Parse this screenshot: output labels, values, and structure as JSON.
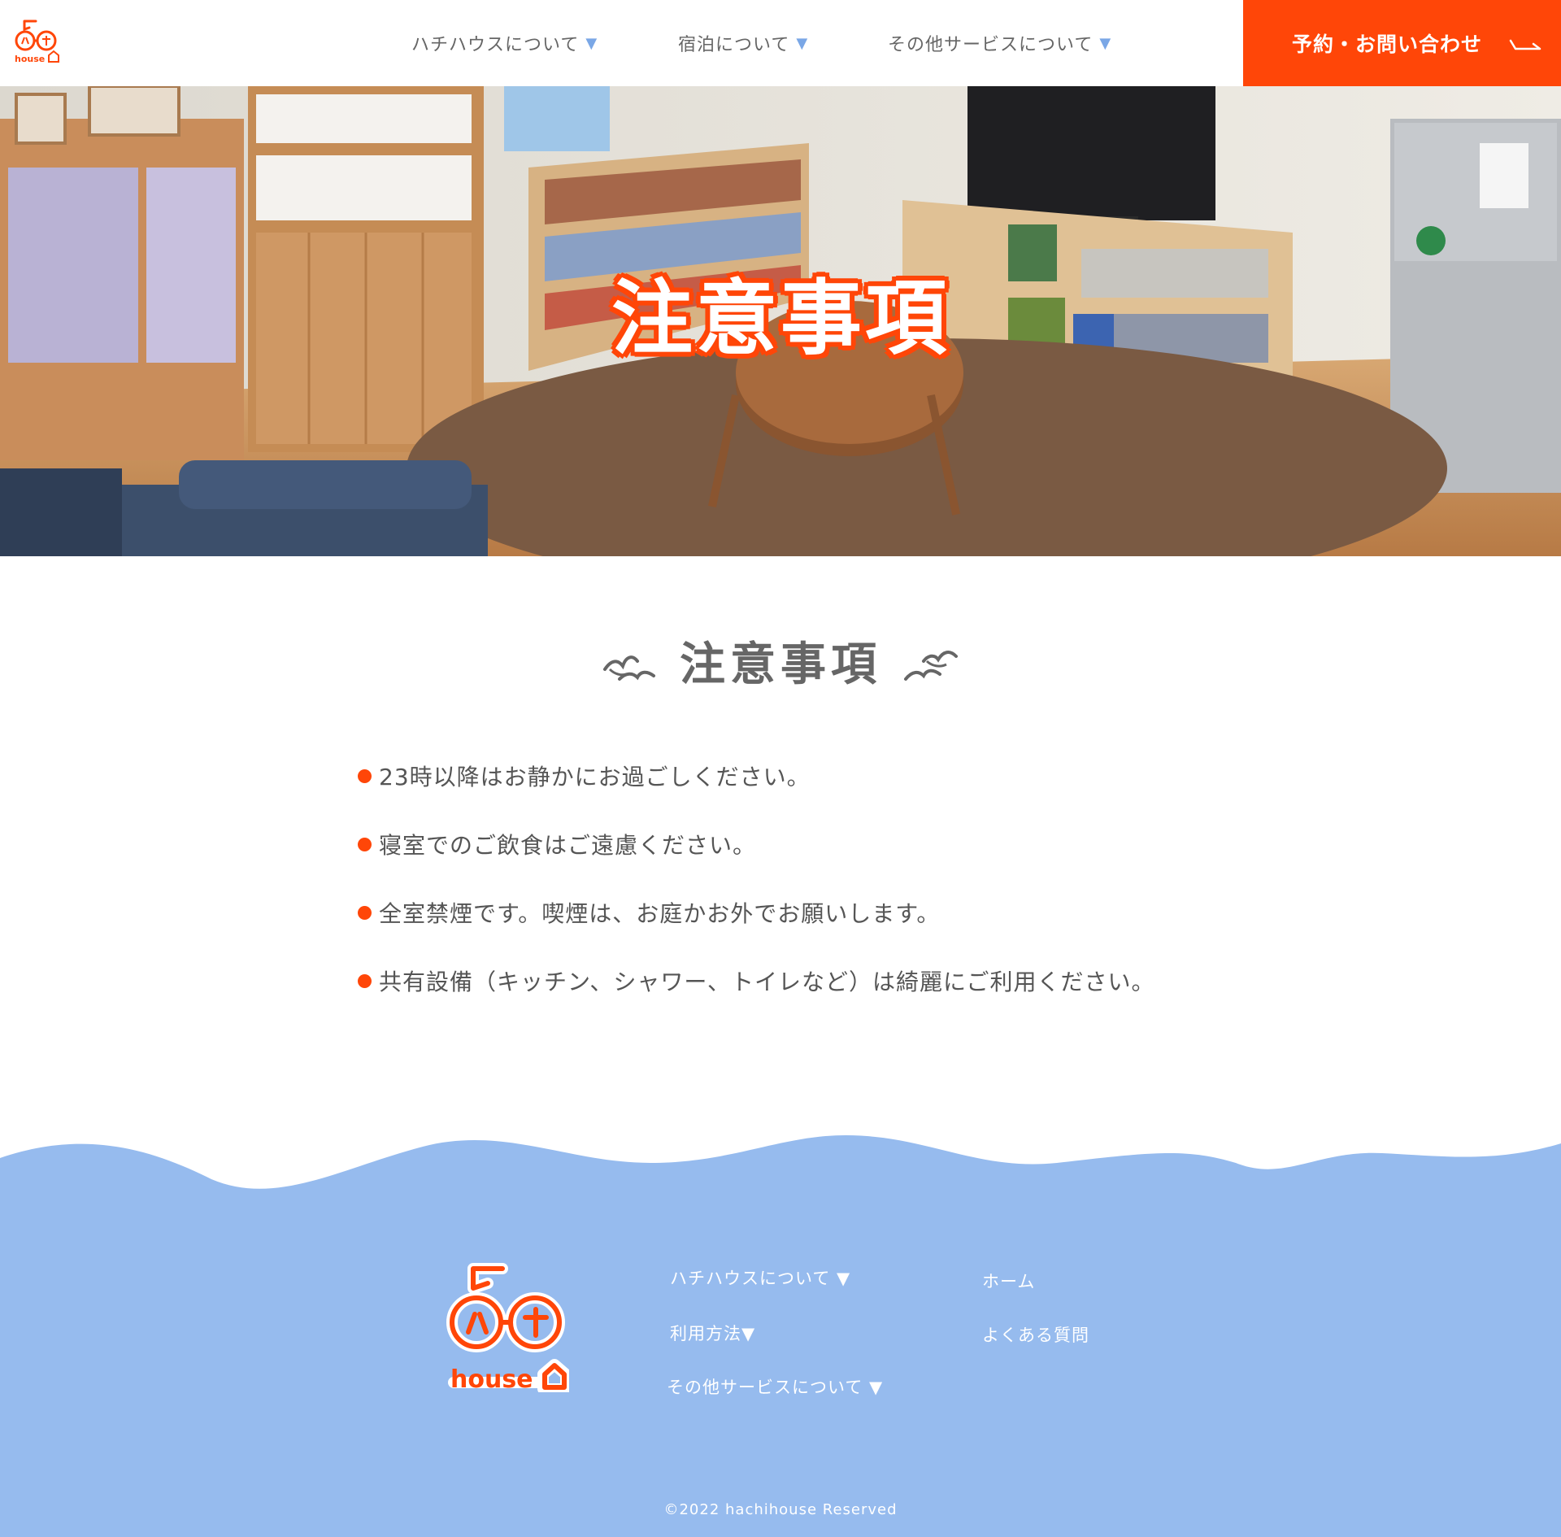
{
  "header": {
    "logo_text": "house",
    "nav": [
      {
        "label": "ハチハウスについて",
        "caret": "▼"
      },
      {
        "label": "宿泊について",
        "caret": "▼"
      },
      {
        "label": "その他サービスについて",
        "caret": "▼"
      }
    ],
    "cta_label": "予約・お問い合わせ"
  },
  "hero": {
    "title": "注意事項",
    "image": "hostel-lounge-photo"
  },
  "main": {
    "heading": "注意事項",
    "notes": [
      "23時以降はお静かにお過ごしください。",
      "寝室でのご飲食はご遠慮ください。",
      "全室禁煙です。喫煙は、お庭かお外でお願いします。",
      "共有設備（キッチン、シャワー、トイレなど）は綺麗にご利用ください。"
    ]
  },
  "footer": {
    "logo_text": "house",
    "links_left": [
      "ハチハウスについて ▼",
      "利用方法▼",
      "その他サービスについて ▼"
    ],
    "links_right": [
      "ホーム",
      "よくある質問"
    ],
    "copyright": "©2022 hachihouse Reserved"
  },
  "colors": {
    "accent": "#ff4608",
    "footer_bg": "#96bbee",
    "text": "#555555",
    "caret": "#7aa7e6"
  },
  "icons": {
    "bullet": "orange-dot",
    "heading_decoration": "seagull-icon",
    "cta_arrow": "arrow-right-icon"
  }
}
